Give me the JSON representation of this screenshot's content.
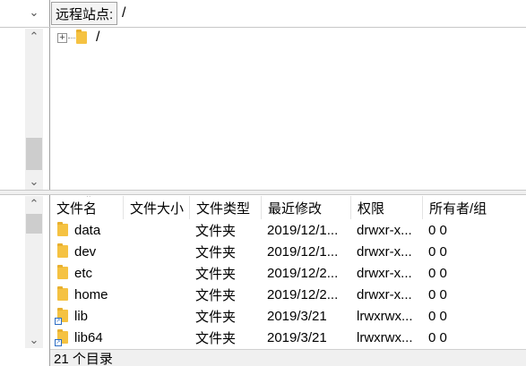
{
  "address_bar": {
    "label": "远程站点:",
    "path": "/"
  },
  "tree": {
    "expander": "+",
    "root_label": "/"
  },
  "file_list": {
    "columns": [
      "文件名",
      "文件大小",
      "文件类型",
      "最近修改",
      "权限",
      "所有者/组"
    ],
    "rows": [
      {
        "name": "data",
        "size": "",
        "type": "文件夹",
        "modified": "2019/12/1...",
        "perms": "drwxr-x...",
        "owner": "0 0",
        "symlink": false
      },
      {
        "name": "dev",
        "size": "",
        "type": "文件夹",
        "modified": "2019/12/1...",
        "perms": "drwxr-x...",
        "owner": "0 0",
        "symlink": false
      },
      {
        "name": "etc",
        "size": "",
        "type": "文件夹",
        "modified": "2019/12/2...",
        "perms": "drwxr-x...",
        "owner": "0 0",
        "symlink": false
      },
      {
        "name": "home",
        "size": "",
        "type": "文件夹",
        "modified": "2019/12/2...",
        "perms": "drwxr-x...",
        "owner": "0 0",
        "symlink": false
      },
      {
        "name": "lib",
        "size": "",
        "type": "文件夹",
        "modified": "2019/3/21",
        "perms": "lrwxrwx...",
        "owner": "0 0",
        "symlink": true
      },
      {
        "name": "lib64",
        "size": "",
        "type": "文件夹",
        "modified": "2019/3/21",
        "perms": "lrwxrwx...",
        "owner": "0 0",
        "symlink": true
      }
    ]
  },
  "status_bar": {
    "text": "21 个目录"
  },
  "icons": {
    "folder": "folder-icon",
    "symlink": "symlink-badge-icon",
    "dropdown": "chevron-down-icon"
  },
  "colors": {
    "folder": "#f5c242",
    "scroll_thumb": "#cdcdcd"
  }
}
